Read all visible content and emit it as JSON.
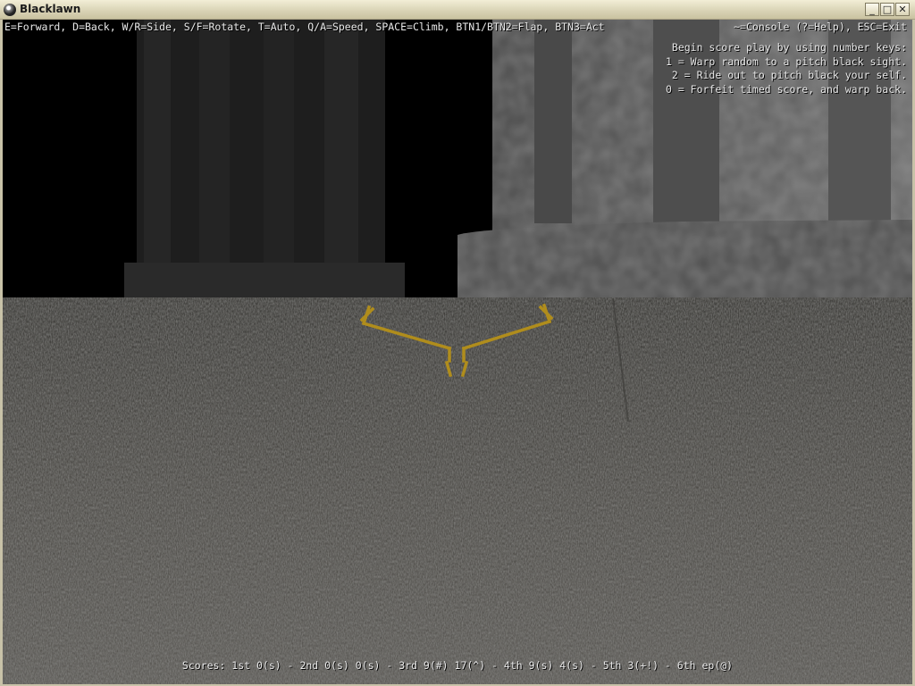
{
  "window": {
    "title": "Blacklawn",
    "minimize": "_",
    "maximize": "□",
    "close": "✕"
  },
  "hud": {
    "controls": "E=Forward, D=Back, W/R=Side, S/F=Rotate, T=Auto, Q/A=Speed, SPACE=Climb, BTN1/BTN2=Flap, BTN3=Act",
    "console": "~=Console (?=Help), ESC=Exit",
    "instructions": [
      "Begin score play by using number keys:",
      "1 = Warp random to a pitch black sight.",
      "2 = Ride out to pitch black your self.",
      "0 = Forfeit timed score, and warp back."
    ],
    "scores": "Scores: 1st 0(s) - 2nd 0(s) 0(s) - 3rd 9(#) 17(^) - 4th 9(s) 4(s) - 5th 3(+!) - 6th ep(@)"
  },
  "colors": {
    "wings": "#c9a227",
    "ground": "#4a4845",
    "wall": "#585858"
  }
}
